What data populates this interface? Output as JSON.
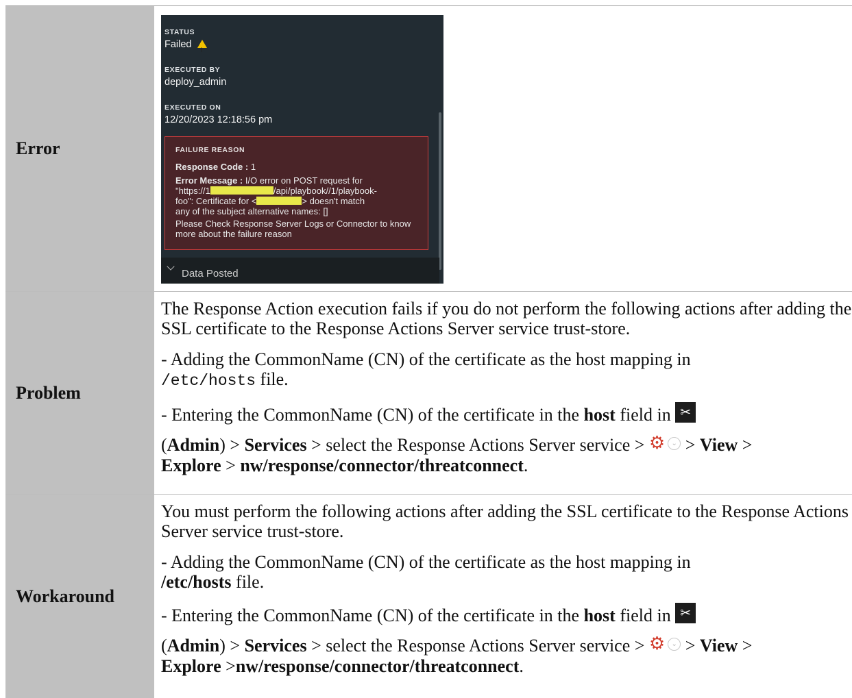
{
  "rows": {
    "error": {
      "heading": "Error",
      "screenshot": {
        "status_label": "STATUS",
        "status_value": "Failed",
        "executed_by_label": "EXECUTED BY",
        "executed_by_value": "deploy_admin",
        "executed_on_label": "EXECUTED ON",
        "executed_on_value": "12/20/2023 12:18:56 pm",
        "failure_reason_label": "FAILURE REASON",
        "response_code_label": "Response Code :",
        "response_code_value": "1",
        "error_message_label": "Error Message :",
        "error_message_part1": "I/O error on POST request for",
        "error_message_part2a": "\"https://1",
        "error_message_part2b": "/api/playbook//1/playbook-",
        "error_message_part3a": "foo\": Certificate for <",
        "error_message_part3b": "> doesn't match",
        "error_message_part4": "any of the subject alternative names: []",
        "hint": "Please Check Response Server Logs or Connector to know more about the failure reason",
        "data_posted": "Data Posted",
        "warning_icon_color": "#f2c200"
      }
    },
    "problem": {
      "heading": "Problem",
      "intro": "The Response Action execution fails if you do not perform the following actions after adding the SSL certificate to the Response Actions Server service trust-store.",
      "step1_text": "- Adding the CommonName (CN) of the certificate as the host mapping in",
      "step1_path": "/etc/hosts",
      "step1_suffix": "file.",
      "step2_pre": "- Entering the CommonName (CN) of the certificate in the",
      "step2_host": "host",
      "step2_field_in": "field in",
      "admin_open": "(",
      "admin": "Admin",
      "admin_close": ")",
      "gt": ">",
      "services": "Services",
      "select_text": "> select the Response Actions Server service >",
      "view": "View",
      "explore": "Explore",
      "node_path": "nw/response/connector/threatconnect",
      "period": "."
    },
    "workaround": {
      "heading": "Workaround",
      "intro": "You must perform the following actions after adding the SSL certificate to the Response Actions Server service trust-store.",
      "step1_text": "- Adding the CommonName (CN) of the certificate as the host mapping in",
      "step1_path": "/etc/hosts",
      "step1_suffix": "file.",
      "step2_pre": "- Entering the CommonName (CN) of the certificate in the",
      "step2_host": "host",
      "step2_field_in": "field in",
      "admin_open": "(",
      "admin": "Admin",
      "admin_close": ")",
      "gt": ">",
      "services": "Services",
      "select_text": "> select the Response Actions Server service >",
      "view": "View",
      "explore": "Explore",
      "node_path": "nw/response/connector/threatconnect",
      "period": "."
    }
  },
  "icons": {
    "admin_icon": "admin-tools-icon",
    "gear_icon": "gear-icon",
    "dropdown_icon": "chevron-down-icon",
    "gear_color": "#d23c2c"
  }
}
